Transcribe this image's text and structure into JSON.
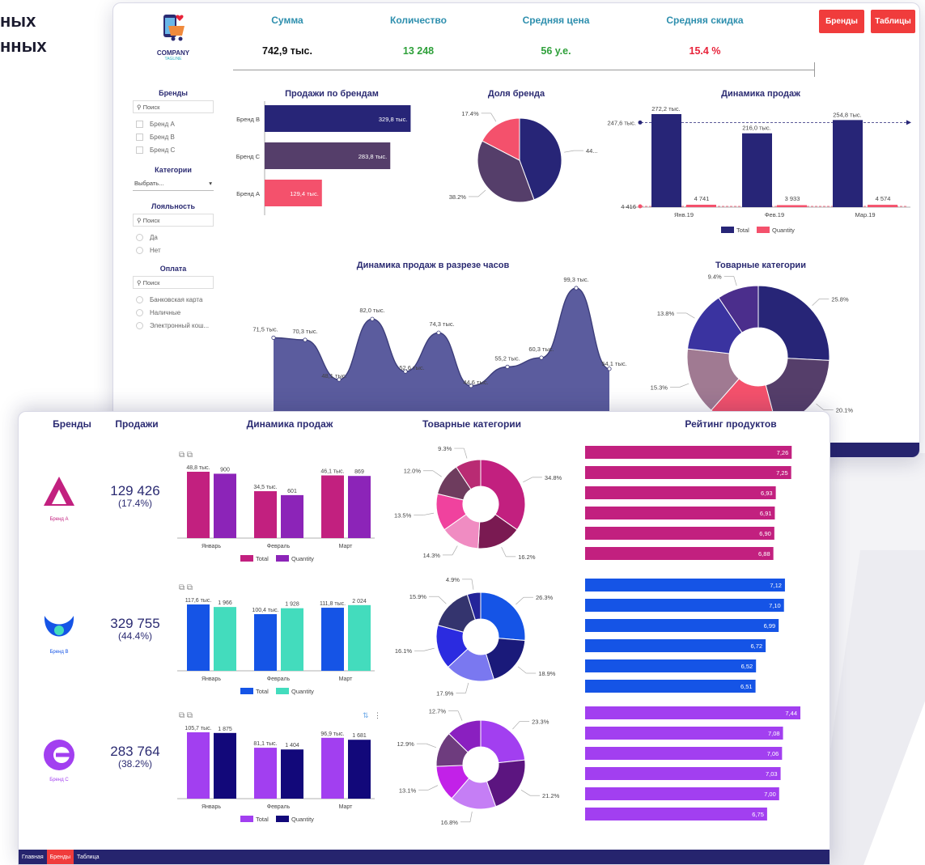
{
  "hero": {
    "lines": [
      "ных",
      "нных"
    ]
  },
  "colors": {
    "navy": "#272577",
    "plum": "#553e6a",
    "rose": "#f4516c",
    "red_btn": "#f03c3c",
    "teal": "#2e8fae",
    "magenta": "#c2207f",
    "purple": "#8c24b8",
    "blue": "#1554e6",
    "mint": "#43dcbd",
    "violet": "#a23ff0",
    "deep_navy": "#12087a",
    "footer": "#26246e"
  },
  "dashboard": {
    "logo": {
      "text": "COMPANY",
      "sub": "TAGLINE",
      "icon": "phone-cart-icon"
    },
    "kpis": [
      {
        "label": "Сумма",
        "value": "742,9 тыс.",
        "color": "#111111"
      },
      {
        "label": "Количество",
        "value": "13 248",
        "color": "#2ea03a"
      },
      {
        "label": "Средняя цена",
        "value": "56 у.е.",
        "color": "#2ea03a"
      },
      {
        "label": "Средняя скидка",
        "value": "15.4 %",
        "color": "#e8233a"
      }
    ],
    "buttons": {
      "brands": "Бренды",
      "tables": "Таблицы"
    },
    "filters": {
      "brands_title": "Бренды",
      "search": "Поиск",
      "brand_items": [
        "Бренд А",
        "Бренд B",
        "Бренд C"
      ],
      "categories_title": "Категории",
      "categories_select": "Выбрать...",
      "loyalty_title": "Лояльность",
      "loyalty_items": [
        "Да",
        "Нет"
      ],
      "payment_title": "Оплата",
      "payment_items": [
        "Банковская карта",
        "Наличные",
        "Электронный кош..."
      ]
    },
    "titles": {
      "brand_sales": "Продажи по брендам",
      "brand_share": "Доля бренда",
      "sales_dynamics": "Динамика продаж",
      "hourly": "Динамика продаж в разрезе часов",
      "categories": "Товарные категории"
    }
  },
  "brands_page": {
    "headers": {
      "brands": "Бренды",
      "sales": "Продажи",
      "dynamics": "Динамика продаж",
      "categories": "Товарные категории",
      "rating": "Рейтинг продуктов"
    },
    "brands": [
      {
        "logo_label": "Бренд А",
        "sales": "129 426",
        "share": "(17.4%)"
      },
      {
        "logo_label": "Бренд B",
        "sales": "329 755",
        "share": "(44.4%)"
      },
      {
        "logo_label": "Бренд C",
        "sales": "283 764",
        "share": "(38.2%)"
      }
    ],
    "footer_tabs": [
      "Главная",
      "Бренды",
      "Таблица"
    ],
    "active_tab": "Бренды"
  },
  "chart_data": [
    {
      "type": "bar",
      "title": "Продажи по брендам",
      "orientation": "horizontal",
      "categories": [
        "Бренд B",
        "Бренд C",
        "Бренд А"
      ],
      "values": [
        329.8,
        283.8,
        129.4
      ],
      "labels": [
        "329,8 тыс.",
        "283,8 тыс.",
        "129,4 тыс."
      ],
      "colors": [
        "#272577",
        "#553e6a",
        "#f4516c"
      ]
    },
    {
      "type": "pie",
      "title": "Доля бренда",
      "values": [
        44.4,
        38.2,
        17.4
      ],
      "labels": [
        "44...",
        "38.2%",
        "17.4%"
      ],
      "colors": [
        "#272577",
        "#553e6a",
        "#f4516c"
      ]
    },
    {
      "type": "bar",
      "title": "Динамика продаж",
      "categories": [
        "Янв.19",
        "Фев.19",
        "Мар.19"
      ],
      "series": [
        {
          "name": "Total",
          "values": [
            272.2,
            216.0,
            254.8
          ],
          "labels": [
            "272,2 тыс.",
            "216,0 тыс.",
            "254,8 тыс."
          ],
          "color": "#272577"
        },
        {
          "name": "Quantity",
          "values": [
            4741,
            3933,
            4574
          ],
          "labels": [
            "4 741",
            "3 933",
            "4 574"
          ],
          "color": "#f4516c"
        }
      ],
      "reference_lines": [
        {
          "label": "247,6 тыс.",
          "value": 247.6
        },
        {
          "label": "4 416",
          "value": 4416
        }
      ],
      "legend": "bottom"
    },
    {
      "type": "area",
      "title": "Динамика продаж в разрезе часов",
      "values": [
        71.5,
        70.3,
        48.1,
        82.0,
        52.6,
        74.3,
        44.6,
        55.2,
        60.3,
        99.3,
        54.1
      ],
      "labels": [
        "71,5 тыс.",
        "70,3 тыс.",
        "48,1 тыс.",
        "82,0 тыс.",
        "52,6 тыс.",
        "74,3 тыс.",
        "44,6 тыс.",
        "55,2 тыс.",
        "60,3 тыс.",
        "99,3 тыс.",
        "54,1 тыс."
      ],
      "color": "#5b5c9e"
    },
    {
      "type": "pie",
      "title": "Товарные категории",
      "donut": true,
      "values": [
        25.8,
        20.1,
        15.6,
        15.3,
        13.8,
        9.4
      ],
      "labels": [
        "25.8%",
        "20.1%",
        "",
        "15.3%",
        "13.8%",
        "9.4%"
      ],
      "colors": [
        "#272577",
        "#553e6a",
        "#f4516c",
        "#a07a92",
        "#3a33a0",
        "#4b2e8c"
      ]
    },
    {
      "type": "bar",
      "brand": "Бренд А",
      "categories": [
        "Январь",
        "Февраль",
        "Март"
      ],
      "series": [
        {
          "name": "Total",
          "values": [
            48.8,
            34.5,
            46.1
          ],
          "labels": [
            "48,8 тыс.",
            "34,5 тыс.",
            "46,1 тыс."
          ],
          "color": "#c2207f"
        },
        {
          "name": "Quantity",
          "values": [
            900,
            601,
            869
          ],
          "labels": [
            "900",
            "601",
            "869"
          ],
          "color": "#8c24b8"
        }
      ]
    },
    {
      "type": "pie",
      "brand": "Бренд А",
      "donut": true,
      "values": [
        34.8,
        16.2,
        14.3,
        13.5,
        12.0,
        9.3
      ],
      "labels": [
        "34.8%",
        "16.2%",
        "14.3%",
        "13.5%",
        "12.0%",
        "9.3%"
      ],
      "colors": [
        "#c2207f",
        "#7a1a52",
        "#f08cc2",
        "#f0429e",
        "#6e3c5e",
        "#b92b73"
      ]
    },
    {
      "type": "bar",
      "brand": "Бренд А",
      "orientation": "horizontal",
      "values": [
        7.26,
        7.25,
        6.93,
        6.91,
        6.9,
        6.88
      ],
      "labels": [
        "7,26",
        "7,25",
        "6,93",
        "6,91",
        "6,90",
        "6,88"
      ],
      "color": "#c2207f"
    },
    {
      "type": "bar",
      "brand": "Бренд B",
      "categories": [
        "Январь",
        "Февраль",
        "Март"
      ],
      "series": [
        {
          "name": "Total",
          "values": [
            117.6,
            100.4,
            111.8
          ],
          "labels": [
            "117,6 тыс.",
            "100,4 тыс.",
            "111,8 тыс."
          ],
          "color": "#1554e6"
        },
        {
          "name": "Quantity",
          "values": [
            1966,
            1928,
            2024
          ],
          "labels": [
            "1 966",
            "1 928",
            "2 024"
          ],
          "color": "#43dcbd"
        }
      ]
    },
    {
      "type": "pie",
      "brand": "Бренд B",
      "donut": true,
      "values": [
        26.3,
        18.9,
        17.9,
        16.1,
        15.9,
        4.9
      ],
      "labels": [
        "26.3%",
        "18.9%",
        "17.9%",
        "16.1%",
        "15.9%",
        "4.9%"
      ],
      "colors": [
        "#1554e6",
        "#1a1a7a",
        "#7a78f0",
        "#2b2be0",
        "#34346e",
        "#24249a"
      ]
    },
    {
      "type": "bar",
      "brand": "Бренд B",
      "orientation": "horizontal",
      "values": [
        7.12,
        7.1,
        6.99,
        6.72,
        6.52,
        6.51
      ],
      "labels": [
        "7,12",
        "7,10",
        "6,99",
        "6,72",
        "6,52",
        "6,51"
      ],
      "color": "#1554e6"
    },
    {
      "type": "bar",
      "brand": "Бренд C",
      "categories": [
        "Январь",
        "Февраль",
        "Март"
      ],
      "series": [
        {
          "name": "Total",
          "values": [
            105.7,
            81.1,
            96.9
          ],
          "labels": [
            "105,7 тыс.",
            "81,1 тыс.",
            "96,9 тыс."
          ],
          "color": "#a23ff0"
        },
        {
          "name": "Quantity",
          "values": [
            1875,
            1404,
            1681
          ],
          "labels": [
            "1 875",
            "1 404",
            "1 681"
          ],
          "color": "#12087a"
        }
      ]
    },
    {
      "type": "pie",
      "brand": "Бренд C",
      "donut": true,
      "values": [
        23.3,
        21.2,
        16.8,
        13.1,
        12.9,
        12.7
      ],
      "labels": [
        "23.3%",
        "21.2%",
        "16.8%",
        "13.1%",
        "12.9%",
        "12.7%"
      ],
      "colors": [
        "#a23ff0",
        "#5c1580",
        "#c57ef5",
        "#c221e8",
        "#6e3c7e",
        "#8a1fc0"
      ]
    },
    {
      "type": "bar",
      "brand": "Бренд C",
      "orientation": "horizontal",
      "values": [
        7.44,
        7.08,
        7.06,
        7.03,
        7.0,
        6.75
      ],
      "labels": [
        "7,44",
        "7,08",
        "7,06",
        "7,03",
        "7,00",
        "6,75"
      ],
      "color": "#a23ff0"
    }
  ]
}
